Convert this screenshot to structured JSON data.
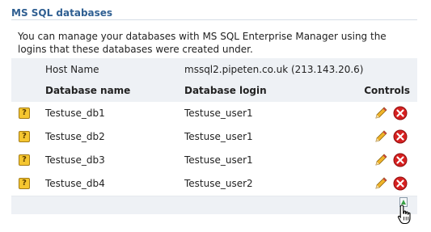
{
  "section": {
    "title": "MS SQL databases"
  },
  "description": "You can manage your databases with MS SQL Enterprise Manager using the logins that these databases were created under.",
  "host": {
    "label": "Host Name",
    "value": "mssql2.pipeten.co.uk (213.143.20.6)"
  },
  "table": {
    "headers": {
      "name": "Database name",
      "login": "Database login",
      "controls": "Controls"
    },
    "rows": [
      {
        "name": "Testuse_db1",
        "login": "Testuse_user1"
      },
      {
        "name": "Testuse_db2",
        "login": "Testuse_user1"
      },
      {
        "name": "Testuse_db3",
        "login": "Testuse_user1"
      },
      {
        "name": "Testuse_db4",
        "login": "Testuse_user2"
      }
    ]
  },
  "icons": {
    "help": "help-icon",
    "edit": "pencil-icon",
    "delete": "delete-icon",
    "add": "add-database-icon"
  },
  "colors": {
    "title": "#2f5f92",
    "panel": "#eef1f5",
    "delete": "#d62020",
    "help": "#f5c630"
  }
}
